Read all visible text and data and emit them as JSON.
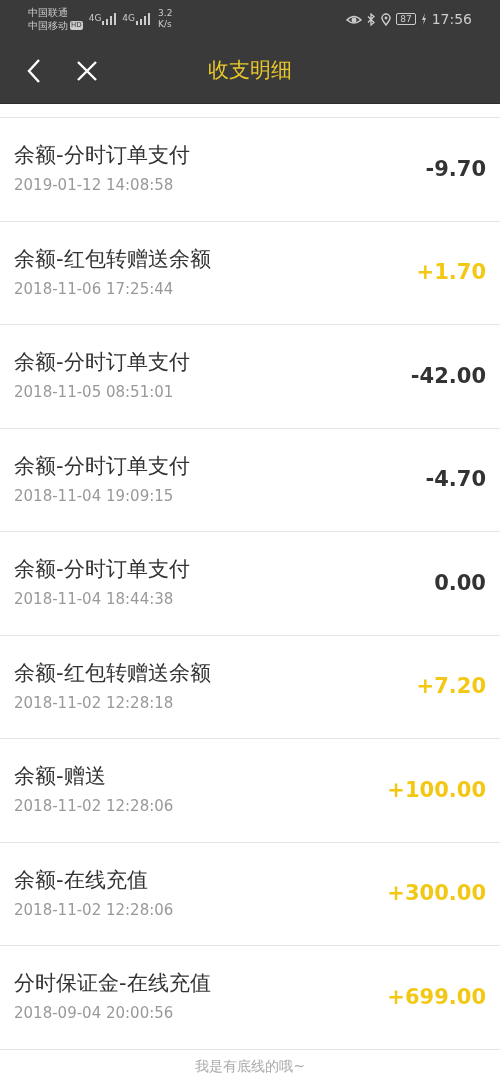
{
  "status_bar": {
    "carriers": [
      "中国联通",
      "中国移动"
    ],
    "hd": "HD",
    "networks": [
      "4G",
      "4G"
    ],
    "speed": [
      "3.2",
      "K/s"
    ],
    "battery": "87",
    "time": "17:56"
  },
  "header": {
    "title": "收支明细"
  },
  "records": [
    {
      "title": "余额-分时订单支付",
      "time": "2019-01-12 14:08:58",
      "amount": "-9.70",
      "color": "#333333"
    },
    {
      "title": "余额-红包转赠送余额",
      "time": "2018-11-06 17:25:44",
      "amount": "+1.70",
      "color": "#f3c814"
    },
    {
      "title": "余额-分时订单支付",
      "time": "2018-11-05 08:51:01",
      "amount": "-42.00",
      "color": "#333333"
    },
    {
      "title": "余额-分时订单支付",
      "time": "2018-11-04 19:09:15",
      "amount": "-4.70",
      "color": "#333333"
    },
    {
      "title": "余额-分时订单支付",
      "time": "2018-11-04 18:44:38",
      "amount": "0.00",
      "color": "#333333"
    },
    {
      "title": "余额-红包转赠送余额",
      "time": "2018-11-02 12:28:18",
      "amount": "+7.20",
      "color": "#f3c814"
    },
    {
      "title": "余额-赠送",
      "time": "2018-11-02 12:28:06",
      "amount": "+100.00",
      "color": "#f3c814"
    },
    {
      "title": "余额-在线充值",
      "time": "2018-11-02 12:28:06",
      "amount": "+300.00",
      "color": "#f3c814"
    },
    {
      "title": "分时保证金-在线充值",
      "time": "2018-09-04 20:00:56",
      "amount": "+699.00",
      "color": "#f3c814"
    }
  ],
  "footer": "我是有底线的哦~"
}
